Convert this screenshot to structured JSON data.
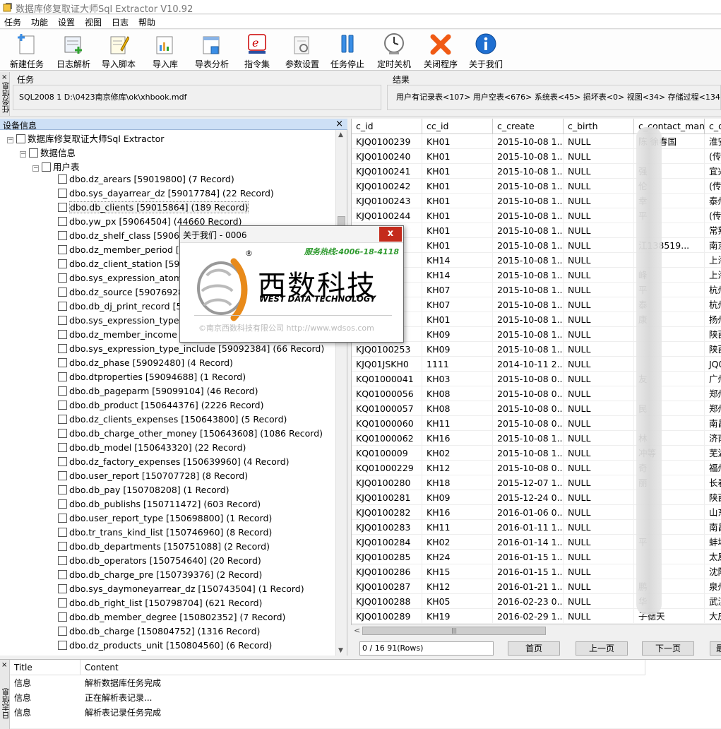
{
  "window": {
    "title": "数据库修复取证大师Sql Extractor V10.92"
  },
  "menu": [
    "任务",
    "功能",
    "设置",
    "视图",
    "日志",
    "帮助"
  ],
  "toolbar": [
    {
      "label": "新建任务",
      "icon": "new-task-icon"
    },
    {
      "label": "日志解析",
      "icon": "log-parse-icon"
    },
    {
      "label": "导入脚本",
      "icon": "import-script-icon"
    },
    {
      "label": "导入库",
      "icon": "import-db-icon"
    },
    {
      "label": "导表分析",
      "icon": "export-analysis-icon"
    },
    {
      "label": "指令集",
      "icon": "command-set-icon"
    },
    {
      "label": "参数设置",
      "icon": "settings-icon"
    },
    {
      "label": "任务停止",
      "icon": "pause-icon"
    },
    {
      "label": "定时关机",
      "icon": "clock-icon"
    },
    {
      "label": "关闭程序",
      "icon": "close-program-icon"
    },
    {
      "label": "关于我们",
      "icon": "info-icon"
    }
  ],
  "info": {
    "side_tab": "任务信息",
    "task_label": "任务",
    "task_value": "SQL2008 1 D:\\0423南京修库\\ok\\xhbook.mdf",
    "result_label": "结果",
    "result_value": "用户有记录表<107> 用户空表<676> 系统表<45> 损坏表<0> 视图<34> 存储过程<134"
  },
  "tree": {
    "header": "设备信息",
    "root": "数据库修复取证大师Sql Extractor",
    "db": "数据信息",
    "group": "用户表",
    "items": [
      "dbo.dz_arears [59019800] (7 Record)",
      "dbo.sys_dayarrear_dz [59017784] (22 Record)",
      "dbo.db_clients [59015864] (189 Record)",
      "dbo.yw_px [59064504] (44660 Record)",
      "dbo.dz_shelf_class [59064",
      "dbo.dz_member_period [59",
      "dbo.dz_client_station [5907",
      "dbo.sys_expression_atom [",
      "dbo.dz_source [59076928] (",
      "dbo.db_dj_print_record [59",
      "dbo.sys_expression_type [5",
      "dbo.dz_member_income [5",
      "dbo.sys_expression_type_include [59092384] (66 Record)",
      "dbo.dz_phase [59092480] (4 Record)",
      "dbo.dtproperties [59094688] (1 Record)",
      "dbo.db_pageparm [59099104] (46 Record)",
      "dbo.db_product [150644376] (2226 Record)",
      "dbo.dz_clients_expenses [150643800] (5 Record)",
      "dbo.db_charge_other_money [150643608] (1086 Record)",
      "dbo.db_model [150643320] (22 Record)",
      "dbo.dz_factory_expenses [150639960] (4 Record)",
      "dbo.user_report [150707728] (8 Record)",
      "dbo.db_pay [150708208] (1 Record)",
      "dbo.db_publishs [150711472] (603 Record)",
      "dbo.user_report_type [150698800] (1 Record)",
      "dbo.tr_trans_kind_list [150746960] (8 Record)",
      "dbo.db_departments [150751088] (2 Record)",
      "dbo.db_operators [150754640] (20 Record)",
      "dbo.db_charge_pre [150739376] (2 Record)",
      "dbo.sys_daymoneyarrear_dz [150743504] (1 Record)",
      "dbo.db_right_list [150798704] (621 Record)",
      "dbo.db_member_degree [150802352] (7 Record)",
      "dbo.db_charge [150804752] (1316 Record)",
      "dbo.dz_products_unit [150804560] (6 Record)"
    ]
  },
  "grid": {
    "columns": [
      "c_id",
      "cc_id",
      "c_create",
      "c_birth",
      "c_contact_man",
      "c_d"
    ],
    "rows": [
      [
        "KJQ0100239",
        "KH01",
        "2015-10-08 1...",
        "NULL",
        "陈  徐春国",
        "淮安"
      ],
      [
        "KJQ0100240",
        "KH01",
        "2015-10-08 1...",
        "NULL",
        "",
        "(传"
      ],
      [
        "KJQ0100241",
        "KH01",
        "2015-10-08 1...",
        "NULL",
        "强",
        "宜兴"
      ],
      [
        "KJQ0100242",
        "KH01",
        "2015-10-08 1...",
        "NULL",
        "伦",
        "(传"
      ],
      [
        "KJQ0100243",
        "KH01",
        "2015-10-08 1...",
        "NULL",
        "幸",
        "泰州"
      ],
      [
        "KJQ0100244",
        "KH01",
        "2015-10-08 1...",
        "NULL",
        "平",
        "(传"
      ],
      [
        "",
        "KH01",
        "2015-10-08 1...",
        "NULL",
        "",
        "常熟"
      ],
      [
        "",
        "KH01",
        "2015-10-08 1...",
        "NULL",
        "江138519...",
        "南京"
      ],
      [
        "",
        "KH14",
        "2015-10-08 1...",
        "NULL",
        "",
        "上海"
      ],
      [
        "",
        "KH14",
        "2015-10-08 1...",
        "NULL",
        "峰",
        "上海"
      ],
      [
        "",
        "KH07",
        "2015-10-08 1...",
        "NULL",
        "平",
        "杭州"
      ],
      [
        "",
        "KH07",
        "2015-10-08 1...",
        "NULL",
        "泰",
        "杭州"
      ],
      [
        "",
        "KH01",
        "2015-10-08 1...",
        "NULL",
        "康",
        "扬州"
      ],
      [
        "",
        "KH09",
        "2015-10-08 1...",
        "NULL",
        "",
        "陕西"
      ],
      [
        "KJQ0100253",
        "KH09",
        "2015-10-08 1...",
        "NULL",
        "",
        "陕西"
      ],
      [
        "KJQ01JSKH0",
        "1111",
        "2014-10-11 2...",
        "NULL",
        "",
        "JQ0"
      ],
      [
        "KQ01000041",
        "KH03",
        "2015-10-08 0...",
        "NULL",
        "友",
        "广州"
      ],
      [
        "KQ01000056",
        "KH08",
        "2015-10-08 0...",
        "NULL",
        "",
        "郑州"
      ],
      [
        "KQ01000057",
        "KH08",
        "2015-10-08 0...",
        "NULL",
        "民",
        "郑州"
      ],
      [
        "KQ01000060",
        "KH11",
        "2015-10-08 0...",
        "NULL",
        "",
        "南昌"
      ],
      [
        "KQ01000062",
        "KH16",
        "2015-10-08 1...",
        "NULL",
        "林",
        "济南"
      ],
      [
        "KQ0100009",
        "KH02",
        "2015-10-08 1...",
        "NULL",
        "冲等",
        "芜湖"
      ],
      [
        "KQ01000229",
        "KH12",
        "2015-10-08 0...",
        "NULL",
        "奇",
        "福州"
      ],
      [
        "KJQ0100280",
        "KH18",
        "2015-12-07 1...",
        "NULL",
        "丽",
        "长春"
      ],
      [
        "KJQ0100281",
        "KH09",
        "2015-12-24 0...",
        "NULL",
        "",
        "陕西"
      ],
      [
        "KJQ0100282",
        "KH16",
        "2016-01-06 0...",
        "NULL",
        "",
        "山东"
      ],
      [
        "KJQ0100283",
        "KH11",
        "2016-01-11 1...",
        "NULL",
        "",
        "南昌"
      ],
      [
        "KJQ0100284",
        "KH02",
        "2016-01-14 1...",
        "NULL",
        "平",
        "蚌埠"
      ],
      [
        "KJQ0100285",
        "KH24",
        "2016-01-15 1...",
        "NULL",
        "",
        "太原"
      ],
      [
        "KJQ0100286",
        "KH15",
        "2016-01-15 1...",
        "NULL",
        "",
        "沈阳"
      ],
      [
        "KJQ0100287",
        "KH12",
        "2016-01-21 1...",
        "NULL",
        "鹏",
        "泉州"
      ],
      [
        "KJQ0100288",
        "KH05",
        "2016-02-23 0...",
        "NULL",
        "华",
        "武汉"
      ],
      [
        "KJQ0100289",
        "KH19",
        "2016-02-29 1...",
        "NULL",
        "子德天",
        "大庆"
      ]
    ]
  },
  "pager": {
    "status": "0 / 16  91(Rows)",
    "first": "首页",
    "prev": "上一页",
    "next": "下一页",
    "last": "最"
  },
  "log": {
    "side_tab": "日志信息",
    "columns": [
      "Title",
      "Content"
    ],
    "rows": [
      [
        "信息",
        "解析数据库任务完成"
      ],
      [
        "信息",
        "正在解析表记录..."
      ],
      [
        "信息",
        "解析表记录任务完成"
      ]
    ]
  },
  "dialog": {
    "title": "关于我们 - 0006",
    "close": "x",
    "hotline": "服务热线:4006-18-4118",
    "brand_cn": "西数科技",
    "reg": "®",
    "brand_en": "WEST DATA TECHNOLOGY",
    "copyright": "©南京西数科技有限公司   http://www.wdsos.com"
  }
}
